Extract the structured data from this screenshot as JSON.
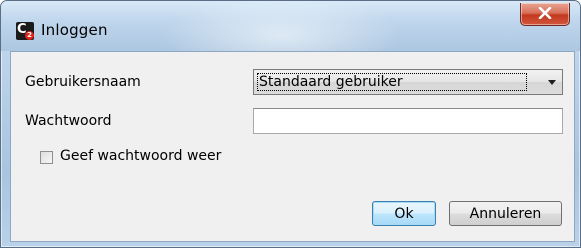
{
  "window": {
    "title": "Inloggen",
    "app_icon": "c2-app-icon",
    "close_icon": "close-x-icon"
  },
  "form": {
    "username_label": "Gebruikersnaam",
    "username_value": "Standaard gebruiker",
    "password_label": "Wachtwoord",
    "password_value": "",
    "show_password_label": "Geef wachtwoord weer",
    "show_password_checked": false
  },
  "buttons": {
    "ok_label": "Ok",
    "cancel_label": "Annuleren"
  },
  "colors": {
    "close_button": "#c2391f",
    "default_button_border": "#3c7fb1"
  }
}
